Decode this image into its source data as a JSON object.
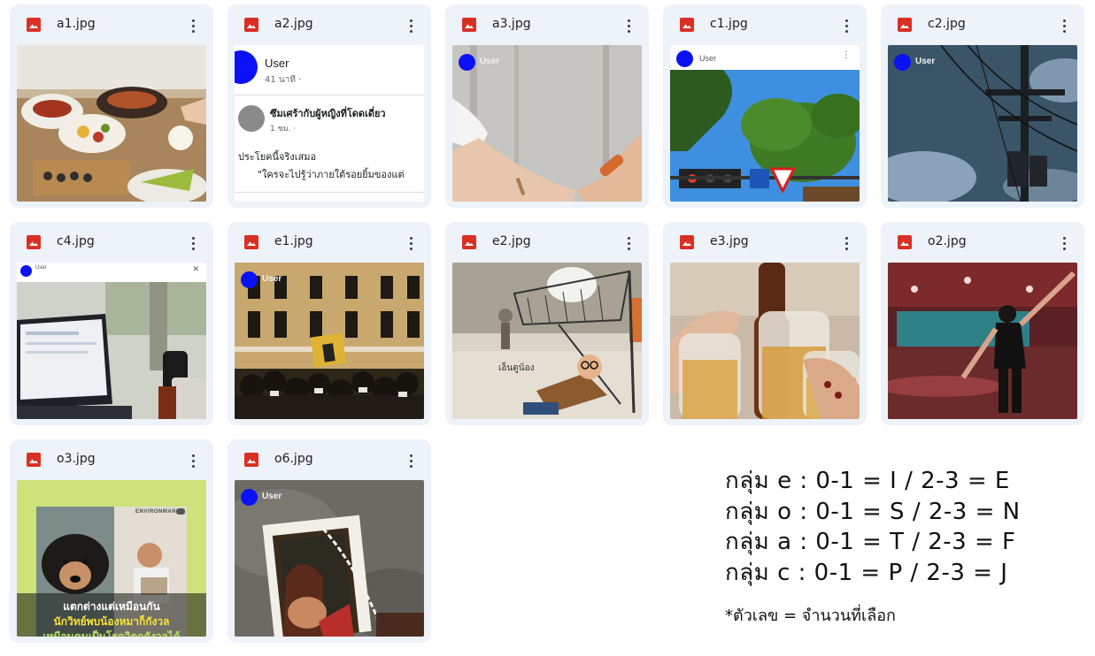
{
  "files": [
    {
      "name": "a1.jpg"
    },
    {
      "name": "a2.jpg",
      "post_user": "User",
      "post_time": "41 นาที ·",
      "shared_title": "ซึมเศร้ากับผู้หญิงที่โดดเดี่ยว",
      "shared_time": "1 ชม. ·",
      "caption": "ประโยคนี้จริงเสมอ",
      "quote": "\"ใครจะไปรู้ว่าภายใต้รอยยิ้มของแต่"
    },
    {
      "name": "a3.jpg",
      "user_label": "User"
    },
    {
      "name": "c1.jpg",
      "user_label": "User"
    },
    {
      "name": "c2.jpg",
      "user_label": "User"
    },
    {
      "name": "c4.jpg",
      "user_label": "User"
    },
    {
      "name": "e1.jpg",
      "user_label": "User"
    },
    {
      "name": "e2.jpg",
      "overlay_text": "เอ็นดูน้อง"
    },
    {
      "name": "e3.jpg"
    },
    {
      "name": "o2.jpg"
    },
    {
      "name": "o3.jpg",
      "brand": "ENVIRONMAN",
      "headline1": "แตกต่างแต่เหมือนกัน",
      "headline2": "นักวิทย์พบน้องหมาก็กังวล",
      "headline3": "เหมือนคนเป็นโรควิตกกังวลได้"
    },
    {
      "name": "o6.jpg",
      "user_label": "User"
    }
  ],
  "legend": {
    "lines": [
      "กลุ่ม e : 0-1 = I / 2-3 = E",
      "กลุ่ม o : 0-1 = S / 2-3 = N",
      "กลุ่ม a : 0-1 = T / 2-3 = F",
      "กลุ่ม c : 0-1 = P / 2-3 = J"
    ],
    "note": "*ตัวเลข = จำนวนที่เลือก"
  },
  "colors": {
    "card_bg": "#eef2f9",
    "image_icon": "#d93025",
    "user_avatar": "#0a12f5"
  },
  "icons": {
    "file_type": "image-file-icon",
    "menu": "more-vert-icon"
  }
}
